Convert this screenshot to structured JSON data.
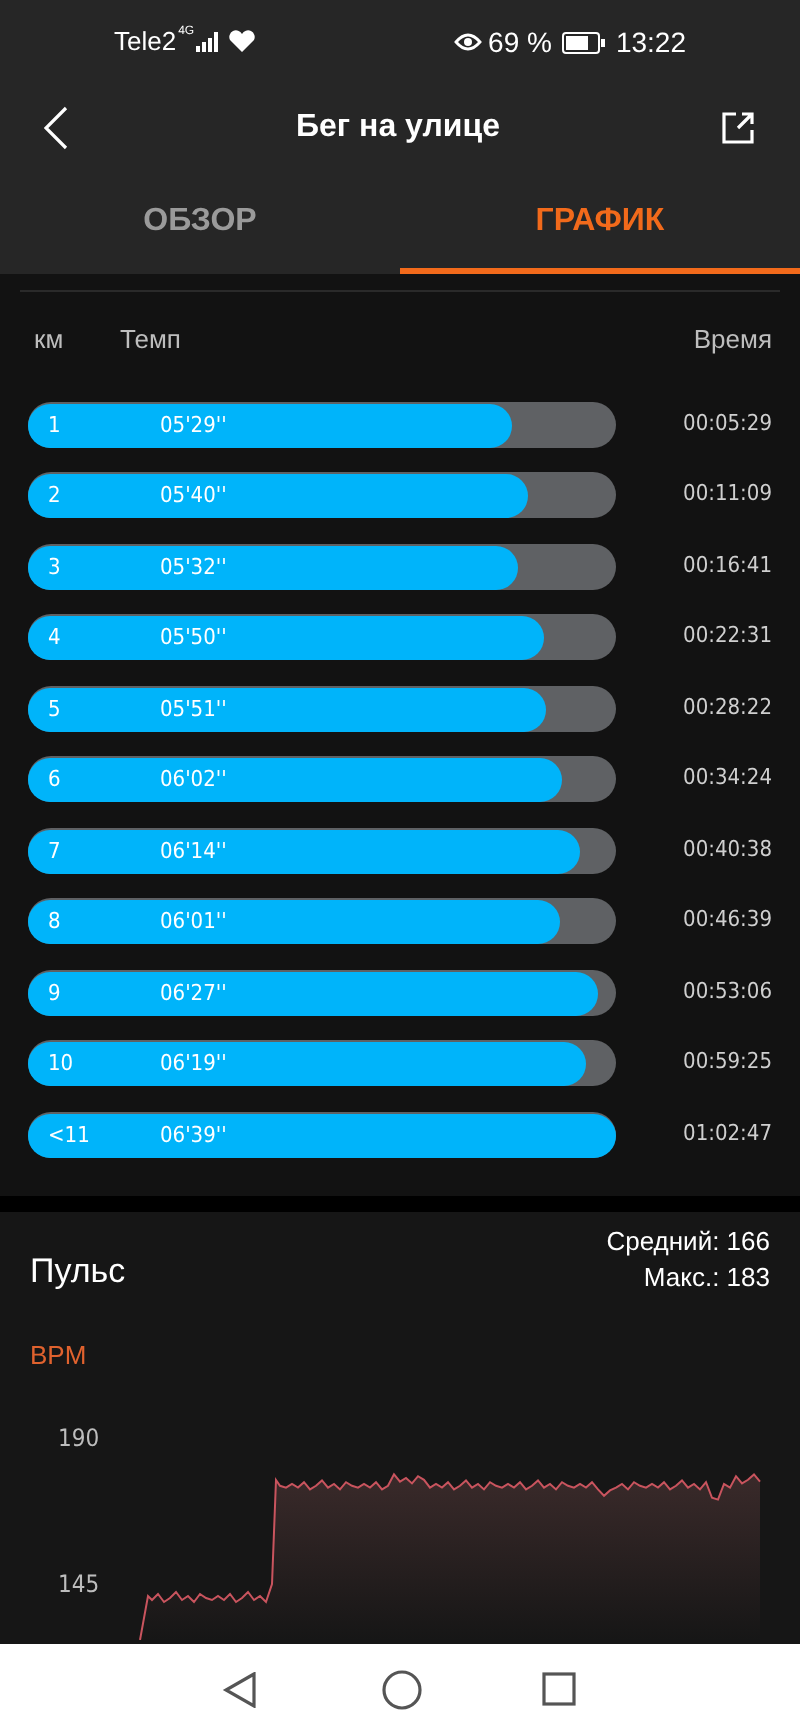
{
  "status_bar": {
    "carrier": "Tele2",
    "network": "4G",
    "battery_percent": "69 %",
    "time": "13:22"
  },
  "header": {
    "title": "Бег на улице"
  },
  "tabs": [
    {
      "label": "ОБЗОР",
      "selected": false
    },
    {
      "label": "ГРАФИК",
      "selected": true
    }
  ],
  "splits": {
    "columns": [
      "км",
      "Темп",
      "Время"
    ],
    "rows": [
      {
        "km": "1",
        "pace": "05'29''",
        "time": "00:05:29",
        "level": 0.823
      },
      {
        "km": "2",
        "pace": "05'40''",
        "time": "00:11:09",
        "level": 0.85
      },
      {
        "km": "3",
        "pace": "05'32''",
        "time": "00:16:41",
        "level": 0.833
      },
      {
        "km": "4",
        "pace": "05'50''",
        "time": "00:22:31",
        "level": 0.878
      },
      {
        "km": "5",
        "pace": "05'51''",
        "time": "00:28:22",
        "level": 0.88
      },
      {
        "km": "6",
        "pace": "06'02''",
        "time": "00:34:24",
        "level": 0.908
      },
      {
        "km": "7",
        "pace": "06'14''",
        "time": "00:40:38",
        "level": 0.939
      },
      {
        "km": "8",
        "pace": "06'01''",
        "time": "00:46:39",
        "level": 0.905
      },
      {
        "km": "9",
        "pace": "06'27''",
        "time": "00:53:06",
        "level": 0.969
      },
      {
        "km": "10",
        "pace": "06'19''",
        "time": "00:59:25",
        "level": 0.949
      },
      {
        "km": "<11",
        "pace": "06'39''",
        "time": "01:02:47",
        "level": 1.0
      }
    ]
  },
  "pulse": {
    "title": "Пульс",
    "average": "Средний: 166",
    "max": "Макс.: 183",
    "unit": "BPM",
    "y_ticks": [
      "190",
      "145"
    ]
  }
}
